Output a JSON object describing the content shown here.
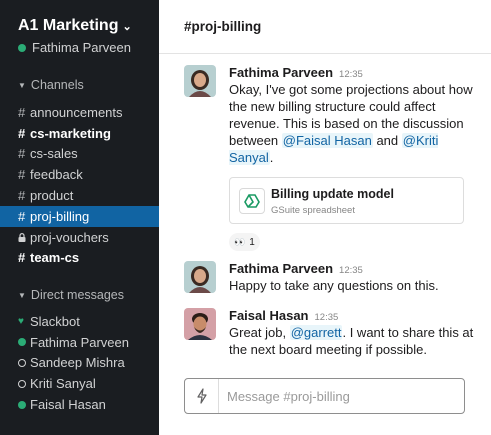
{
  "workspace": {
    "name": "A1 Marketing",
    "user": "Fathima Parveen"
  },
  "sidebar": {
    "channels_label": "Channels",
    "channels": [
      {
        "name": "announcements",
        "bold": false,
        "private": false
      },
      {
        "name": "cs-marketing",
        "bold": true,
        "private": false
      },
      {
        "name": "cs-sales",
        "bold": false,
        "private": false
      },
      {
        "name": "feedback",
        "bold": false,
        "private": false
      },
      {
        "name": "product",
        "bold": false,
        "private": false
      },
      {
        "name": "proj-billing",
        "bold": false,
        "private": false,
        "active": true
      },
      {
        "name": "proj-vouchers",
        "bold": false,
        "private": true
      },
      {
        "name": "team-cs",
        "bold": true,
        "private": false
      }
    ],
    "dm_label": "Direct messages",
    "dms": [
      {
        "name": "Slackbot",
        "status": "heart"
      },
      {
        "name": "Fathima Parveen",
        "status": "online"
      },
      {
        "name": "Sandeep Mishra",
        "status": "away"
      },
      {
        "name": "Kriti Sanyal",
        "status": "away"
      },
      {
        "name": "Faisal Hasan",
        "status": "online"
      }
    ]
  },
  "channel": {
    "title": "#proj-billing"
  },
  "messages": [
    {
      "sender": "Fathima Parveen",
      "time": "12:35",
      "text_a": "Okay, I've got some projections about how the new billing structure could affect revenue. This is based on the discussion between ",
      "mention_1": "@Faisal Hasan",
      "text_b": " and ",
      "mention_2": "@Kriti Sanyal",
      "text_c": ".",
      "file": {
        "title": "Billing update model",
        "subtitle": "GSuite spreadsheet"
      },
      "reaction": {
        "emoji": "👀",
        "count": "1"
      }
    },
    {
      "sender": "Fathima Parveen",
      "time": "12:35",
      "text": "Happy to take any questions on this."
    },
    {
      "sender": "Faisal Hasan",
      "time": "12:35",
      "text_a": "Great job, ",
      "mention": "@garrett",
      "text_b": ". I want to share this at the next board meeting if possible."
    }
  ],
  "composer": {
    "placeholder": "Message #proj-billing"
  },
  "colors": {
    "sidebar": "#1a1d21",
    "active": "#1164a3",
    "online": "#2bac76",
    "mention": "#1264a3"
  }
}
